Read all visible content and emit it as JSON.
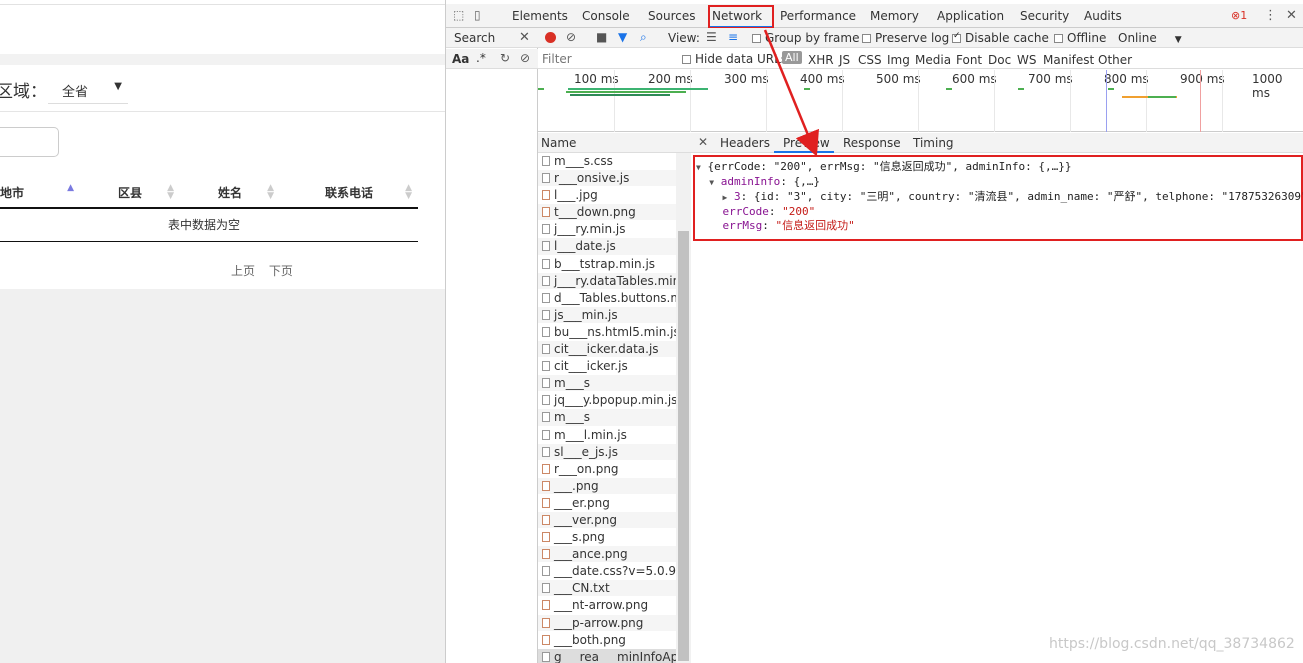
{
  "page": {
    "region_label": "区域：",
    "region_value": "全省",
    "table_headers": [
      "地市",
      "区县",
      "姓名",
      "联系电话"
    ],
    "empty_text": "表中数据为空",
    "pager": {
      "prev": "上页",
      "next": "下页"
    }
  },
  "devtools": {
    "tabs": [
      "Elements",
      "Console",
      "Sources",
      "Network",
      "Performance",
      "Memory",
      "Application",
      "Security",
      "Audits"
    ],
    "active_tab": "Network",
    "error_count": "1",
    "search_label": "Search",
    "search_opts": {
      "case": "Aa",
      "regex": ".*"
    },
    "toolbar": {
      "view_label": "View:",
      "group_by_frame": "Group by frame",
      "preserve_log": "Preserve log",
      "disable_cache": "Disable cache",
      "offline": "Offline",
      "throttle": "Online"
    },
    "filter": {
      "placeholder": "Filter",
      "hide_data_urls": "Hide data URLs",
      "all": "All",
      "types": [
        "XHR",
        "JS",
        "CSS",
        "Img",
        "Media",
        "Font",
        "Doc",
        "WS",
        "Manifest",
        "Other"
      ]
    },
    "timeline_ticks": [
      "100 ms",
      "200 ms",
      "300 ms",
      "400 ms",
      "500 ms",
      "600 ms",
      "700 ms",
      "800 ms",
      "900 ms",
      "1000 ms"
    ],
    "name_header": "Name",
    "requests": [
      "m___s.css",
      "r___onsive.js",
      "l___.jpg",
      "t___down.png",
      "j___ry.min.js",
      "l___date.js",
      "b___tstrap.min.js",
      "j___ry.dataTables.min.js",
      "d___Tables.buttons.min.js",
      "js___min.js",
      "bu___ns.html5.min.js",
      "cit___icker.data.js",
      "cit___icker.js",
      "m___s",
      "jq___y.bpopup.min.js",
      "m___s",
      "m___l.min.js",
      "sl___e_js.js",
      "r___on.png",
      "___.png",
      "___er.png",
      "___ver.png",
      "___s.png",
      "___ance.png",
      "___date.css?v=5.0.9",
      "___CN.txt",
      "___nt-arrow.png",
      "___p-arrow.png",
      "___both.png",
      "g___rea___minInfoApi..."
    ],
    "preview_tabs": [
      "Headers",
      "Preview",
      "Response",
      "Timing"
    ],
    "active_preview_tab": "Preview",
    "json_lines": {
      "l1": "{errCode: \"200\", errMsg: \"信息返回成功\", adminInfo: {,…}}",
      "l2_key": "adminInfo",
      "l2_val": "{,…}",
      "l3_key": "3",
      "l3_val": "{id: \"3\", city: \"三明\", country: \"清流县\", admin_name: \"严舒\", telphone: \"17875326309\"",
      "l4_key": "errCode",
      "l4_val": "\"200\"",
      "l5_key": "errMsg",
      "l5_val": "\"信息返回成功\""
    }
  },
  "watermark": "https://blog.csdn.net/qq_38734862",
  "colors": {
    "highlight": "#e02020",
    "accent": "#1a73e8",
    "record": "#d93025"
  }
}
